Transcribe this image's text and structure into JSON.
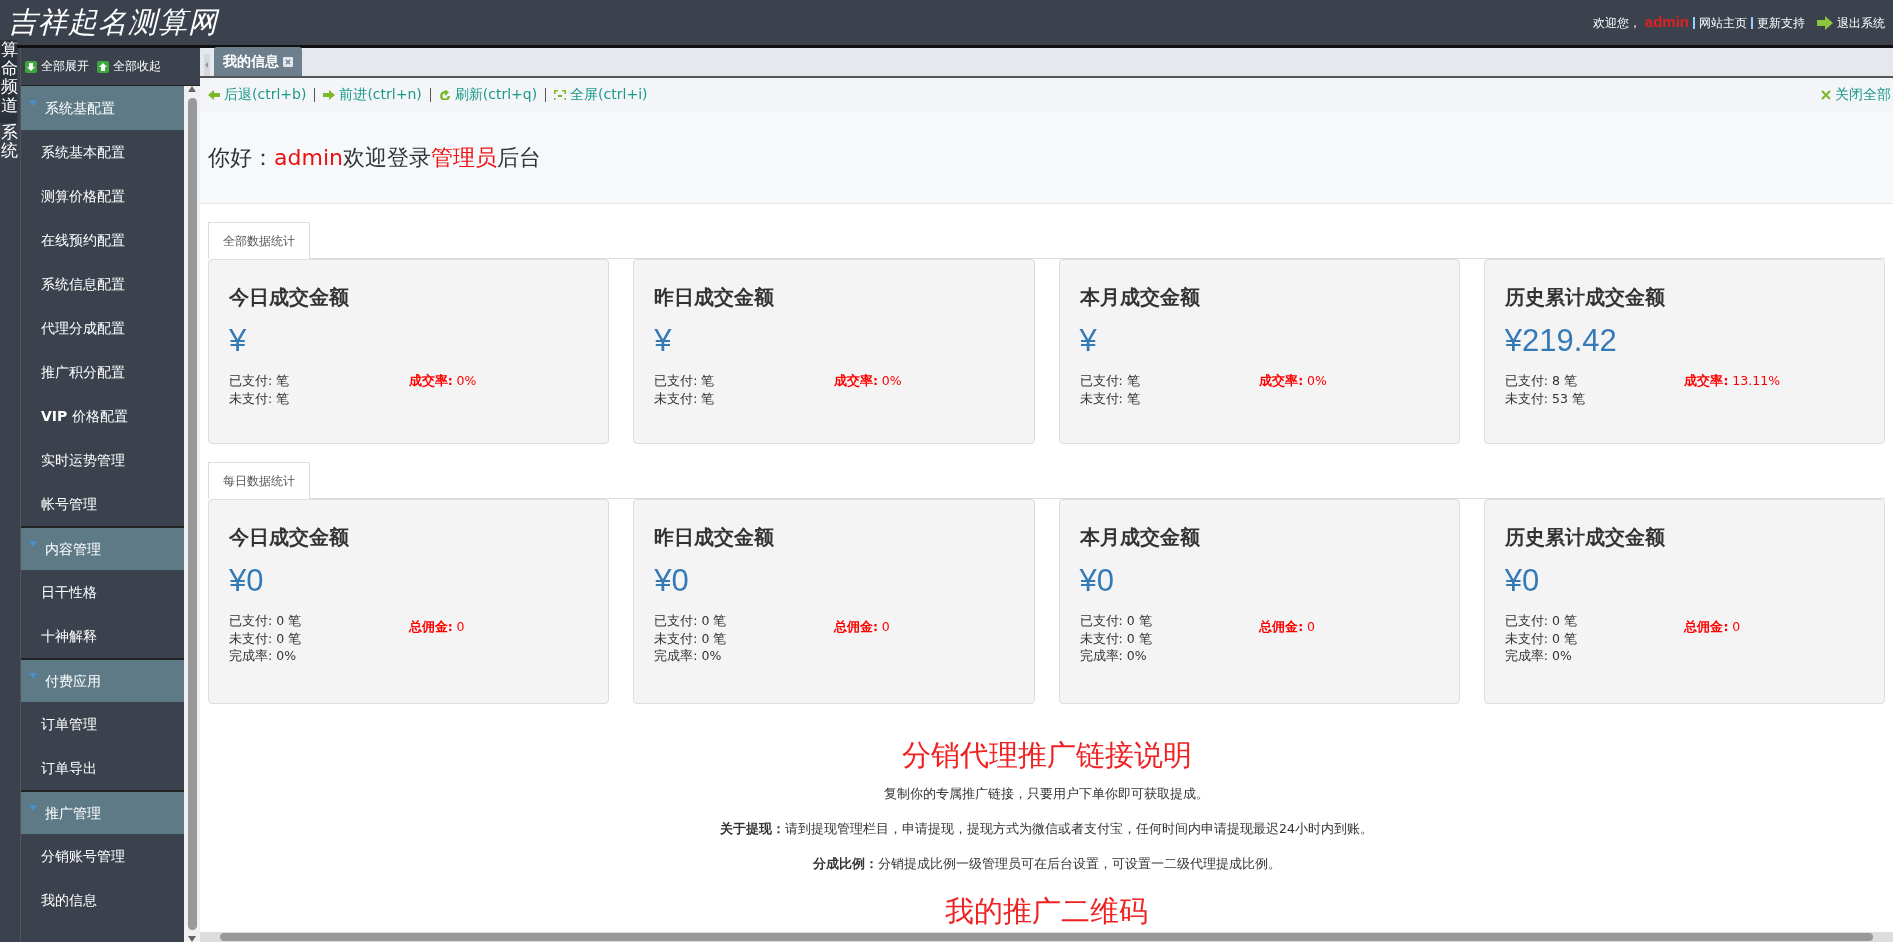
{
  "header": {
    "logo": "吉祥起名测算网",
    "welcome": "欢迎您，",
    "user": "admin",
    "links": [
      "网站主页",
      "更新支持"
    ],
    "logout": "退出系统"
  },
  "channels": [
    {
      "label": "算命频道",
      "selected": true
    },
    {
      "label": "系统",
      "selected": false
    }
  ],
  "sidebar": {
    "expand_all": "全部展开",
    "collapse_all": "全部收起",
    "groups": [
      {
        "title": "系统基配置",
        "items": [
          "系统基本配置",
          "测算价格配置",
          "在线预约配置",
          "系统信息配置",
          "代理分成配置",
          "推广积分配置",
          "**VIP** 价格配置",
          "实时运势管理",
          "帐号管理"
        ]
      },
      {
        "title": "内容管理",
        "items": [
          "日干性格",
          "十神解释"
        ]
      },
      {
        "title": "付费应用",
        "items": [
          "订单管理",
          "订单导出"
        ]
      },
      {
        "title": "推广管理",
        "items": [
          "分销账号管理",
          "我的信息"
        ]
      }
    ]
  },
  "tabs": [
    {
      "label": "我的信息",
      "selected": true
    }
  ],
  "toolbar": {
    "buttons": [
      {
        "kind": "back",
        "label": "后退(ctrl+b)"
      },
      {
        "kind": "forward",
        "label": "前进(ctrl+n)"
      },
      {
        "kind": "refresh",
        "label": "刷新(ctrl+q)"
      },
      {
        "kind": "fullscreen",
        "label": "全屏(ctrl+i)"
      }
    ],
    "close_all": "关闭全部"
  },
  "greeting": [
    {
      "text": "你好：",
      "highlight": false
    },
    {
      "text": "admin",
      "highlight": true
    },
    {
      "text": "欢迎登录",
      "highlight": false
    },
    {
      "text": "管理员",
      "highlight": true
    },
    {
      "text": "后台",
      "highlight": false
    }
  ],
  "sections": [
    {
      "tab": "全部数据统计",
      "cards": [
        {
          "title": "今日成交金额",
          "amount": "¥",
          "lines": [
            "已支付: 笔",
            "未支付: 笔"
          ],
          "stat_label": "成交率:",
          "stat_value": "0%"
        },
        {
          "title": "昨日成交金额",
          "amount": "¥",
          "lines": [
            "已支付: 笔",
            "未支付: 笔"
          ],
          "stat_label": "成交率:",
          "stat_value": "0%"
        },
        {
          "title": "本月成交金额",
          "amount": "¥",
          "lines": [
            "已支付: 笔",
            "未支付: 笔"
          ],
          "stat_label": "成交率:",
          "stat_value": "0%"
        },
        {
          "title": "历史累计成交金额",
          "amount": "¥219.42",
          "lines": [
            "已支付: 8 笔",
            "未支付: 53 笔"
          ],
          "stat_label": "成交率:",
          "stat_value": "13.11%"
        }
      ]
    },
    {
      "tab": "每日数据统计",
      "cards": [
        {
          "title": "今日成交金额",
          "amount": "¥0",
          "lines": [
            "已支付: 0 笔",
            "未支付: 0 笔",
            "完成率: 0%"
          ],
          "stat_label": "总佣金:",
          "stat_value": "0"
        },
        {
          "title": "昨日成交金额",
          "amount": "¥0",
          "lines": [
            "已支付: 0 笔",
            "未支付: 0 笔",
            "完成率: 0%"
          ],
          "stat_label": "总佣金:",
          "stat_value": "0"
        },
        {
          "title": "本月成交金额",
          "amount": "¥0",
          "lines": [
            "已支付: 0 笔",
            "未支付: 0 笔",
            "完成率: 0%"
          ],
          "stat_label": "总佣金:",
          "stat_value": "0"
        },
        {
          "title": "历史累计成交金额",
          "amount": "¥0",
          "lines": [
            "已支付: 0 笔",
            "未支付: 0 笔",
            "完成率: 0%"
          ],
          "stat_label": "总佣金:",
          "stat_value": "0"
        }
      ]
    }
  ],
  "promo": {
    "title": "分销代理推广链接说明",
    "intro": "复制你的专属推广链接，只要用户下单你即可获取提成。",
    "paragraphs": [
      "**关于提现：**请到提现管理栏目，申请提现，提现方式为微信或者支付宝，任何时间内申请提现最迟24小时内到账。",
      "**分成比例：**分销提成比例一级管理员可在后台设置，可设置一二级代理提成比例。"
    ],
    "next_title": "我的推广二维码"
  }
}
